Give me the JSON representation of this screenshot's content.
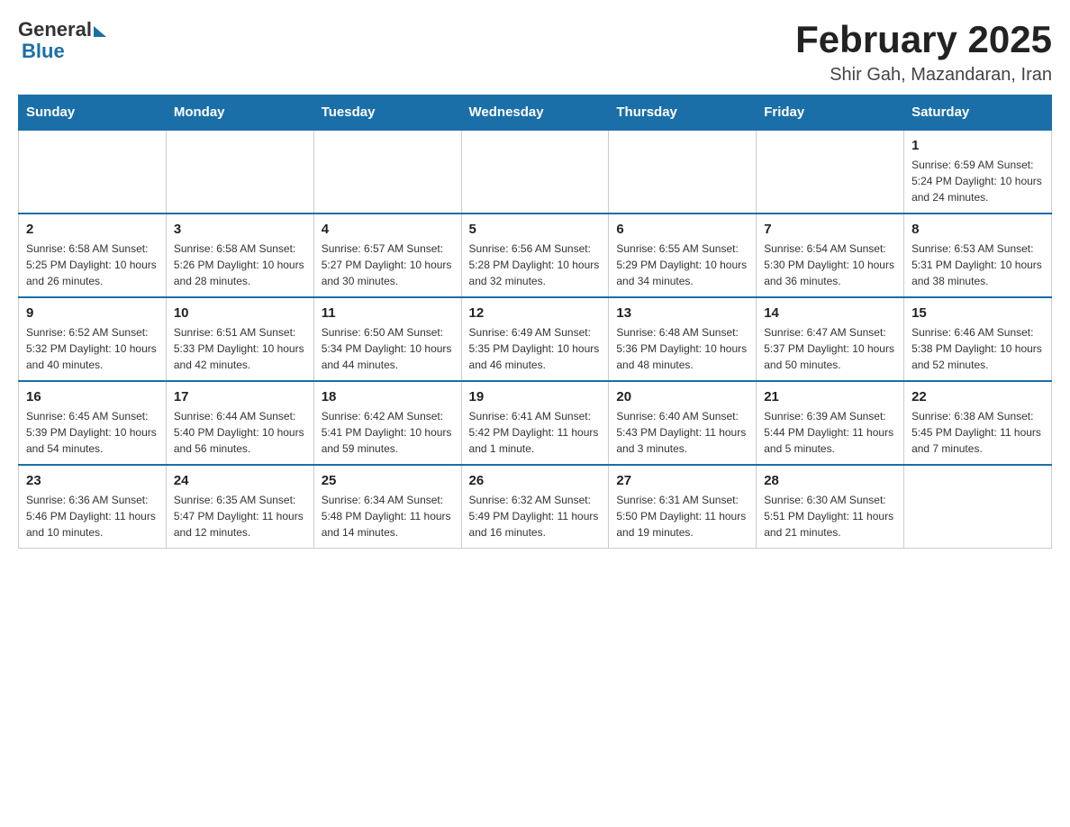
{
  "header": {
    "logo_general": "General",
    "logo_blue": "Blue",
    "month_title": "February 2025",
    "location": "Shir Gah, Mazandaran, Iran"
  },
  "weekdays": [
    "Sunday",
    "Monday",
    "Tuesday",
    "Wednesday",
    "Thursday",
    "Friday",
    "Saturday"
  ],
  "weeks": [
    [
      {
        "day": "",
        "info": ""
      },
      {
        "day": "",
        "info": ""
      },
      {
        "day": "",
        "info": ""
      },
      {
        "day": "",
        "info": ""
      },
      {
        "day": "",
        "info": ""
      },
      {
        "day": "",
        "info": ""
      },
      {
        "day": "1",
        "info": "Sunrise: 6:59 AM\nSunset: 5:24 PM\nDaylight: 10 hours and 24 minutes."
      }
    ],
    [
      {
        "day": "2",
        "info": "Sunrise: 6:58 AM\nSunset: 5:25 PM\nDaylight: 10 hours and 26 minutes."
      },
      {
        "day": "3",
        "info": "Sunrise: 6:58 AM\nSunset: 5:26 PM\nDaylight: 10 hours and 28 minutes."
      },
      {
        "day": "4",
        "info": "Sunrise: 6:57 AM\nSunset: 5:27 PM\nDaylight: 10 hours and 30 minutes."
      },
      {
        "day": "5",
        "info": "Sunrise: 6:56 AM\nSunset: 5:28 PM\nDaylight: 10 hours and 32 minutes."
      },
      {
        "day": "6",
        "info": "Sunrise: 6:55 AM\nSunset: 5:29 PM\nDaylight: 10 hours and 34 minutes."
      },
      {
        "day": "7",
        "info": "Sunrise: 6:54 AM\nSunset: 5:30 PM\nDaylight: 10 hours and 36 minutes."
      },
      {
        "day": "8",
        "info": "Sunrise: 6:53 AM\nSunset: 5:31 PM\nDaylight: 10 hours and 38 minutes."
      }
    ],
    [
      {
        "day": "9",
        "info": "Sunrise: 6:52 AM\nSunset: 5:32 PM\nDaylight: 10 hours and 40 minutes."
      },
      {
        "day": "10",
        "info": "Sunrise: 6:51 AM\nSunset: 5:33 PM\nDaylight: 10 hours and 42 minutes."
      },
      {
        "day": "11",
        "info": "Sunrise: 6:50 AM\nSunset: 5:34 PM\nDaylight: 10 hours and 44 minutes."
      },
      {
        "day": "12",
        "info": "Sunrise: 6:49 AM\nSunset: 5:35 PM\nDaylight: 10 hours and 46 minutes."
      },
      {
        "day": "13",
        "info": "Sunrise: 6:48 AM\nSunset: 5:36 PM\nDaylight: 10 hours and 48 minutes."
      },
      {
        "day": "14",
        "info": "Sunrise: 6:47 AM\nSunset: 5:37 PM\nDaylight: 10 hours and 50 minutes."
      },
      {
        "day": "15",
        "info": "Sunrise: 6:46 AM\nSunset: 5:38 PM\nDaylight: 10 hours and 52 minutes."
      }
    ],
    [
      {
        "day": "16",
        "info": "Sunrise: 6:45 AM\nSunset: 5:39 PM\nDaylight: 10 hours and 54 minutes."
      },
      {
        "day": "17",
        "info": "Sunrise: 6:44 AM\nSunset: 5:40 PM\nDaylight: 10 hours and 56 minutes."
      },
      {
        "day": "18",
        "info": "Sunrise: 6:42 AM\nSunset: 5:41 PM\nDaylight: 10 hours and 59 minutes."
      },
      {
        "day": "19",
        "info": "Sunrise: 6:41 AM\nSunset: 5:42 PM\nDaylight: 11 hours and 1 minute."
      },
      {
        "day": "20",
        "info": "Sunrise: 6:40 AM\nSunset: 5:43 PM\nDaylight: 11 hours and 3 minutes."
      },
      {
        "day": "21",
        "info": "Sunrise: 6:39 AM\nSunset: 5:44 PM\nDaylight: 11 hours and 5 minutes."
      },
      {
        "day": "22",
        "info": "Sunrise: 6:38 AM\nSunset: 5:45 PM\nDaylight: 11 hours and 7 minutes."
      }
    ],
    [
      {
        "day": "23",
        "info": "Sunrise: 6:36 AM\nSunset: 5:46 PM\nDaylight: 11 hours and 10 minutes."
      },
      {
        "day": "24",
        "info": "Sunrise: 6:35 AM\nSunset: 5:47 PM\nDaylight: 11 hours and 12 minutes."
      },
      {
        "day": "25",
        "info": "Sunrise: 6:34 AM\nSunset: 5:48 PM\nDaylight: 11 hours and 14 minutes."
      },
      {
        "day": "26",
        "info": "Sunrise: 6:32 AM\nSunset: 5:49 PM\nDaylight: 11 hours and 16 minutes."
      },
      {
        "day": "27",
        "info": "Sunrise: 6:31 AM\nSunset: 5:50 PM\nDaylight: 11 hours and 19 minutes."
      },
      {
        "day": "28",
        "info": "Sunrise: 6:30 AM\nSunset: 5:51 PM\nDaylight: 11 hours and 21 minutes."
      },
      {
        "day": "",
        "info": ""
      }
    ]
  ]
}
